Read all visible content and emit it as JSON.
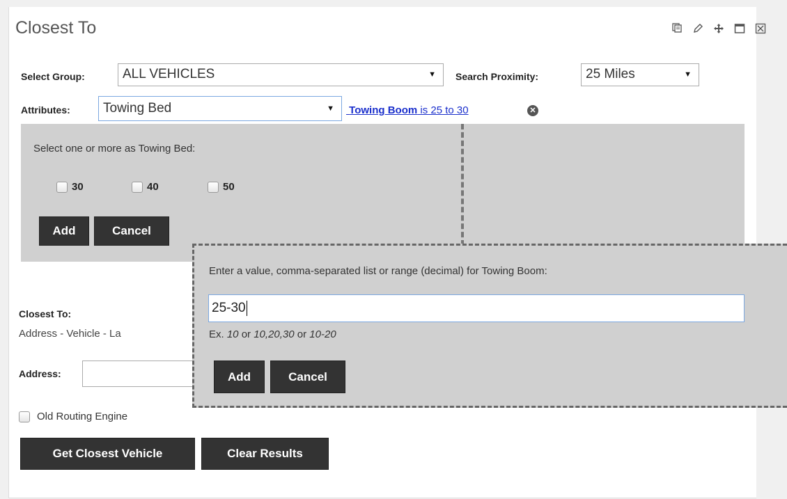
{
  "panel": {
    "title": "Closest To",
    "window_icons": [
      "copy-icon",
      "edit-icon",
      "move-icon",
      "maximize-icon",
      "close-icon"
    ]
  },
  "group": {
    "label": "Select Group:",
    "value": "ALL VEHICLES"
  },
  "proximity": {
    "label": "Search Proximity:",
    "value": "25 Miles"
  },
  "attributes": {
    "label": "Attributes:",
    "value": "Towing Bed",
    "chip": {
      "name": "Towing Boom",
      "text": " is 25 to 30"
    }
  },
  "bed_panel": {
    "prompt": "Select one or more as Towing Bed:",
    "options": [
      {
        "label": "30",
        "checked": false
      },
      {
        "label": "40",
        "checked": false
      },
      {
        "label": "50",
        "checked": false
      }
    ],
    "add_label": "Add",
    "cancel_label": "Cancel"
  },
  "boom_popup": {
    "prompt": "Enter a value, comma-separated list or range (decimal) for Towing Boom:",
    "value": "25-30",
    "example_prefix": "Ex. ",
    "example_1": "10",
    "or_1": " or ",
    "example_2": "10,20,30",
    "or_2": " or ",
    "example_3": "10-20",
    "add_label": "Add",
    "cancel_label": "Cancel"
  },
  "closest_to": {
    "label": "Closest To:",
    "modes_visible": "Address - Vehicle - La",
    "address_label": "Address:",
    "old_routing_label": "Old Routing Engine",
    "get_button": "Get Closest Vehicle",
    "clear_button": "Clear Results"
  }
}
